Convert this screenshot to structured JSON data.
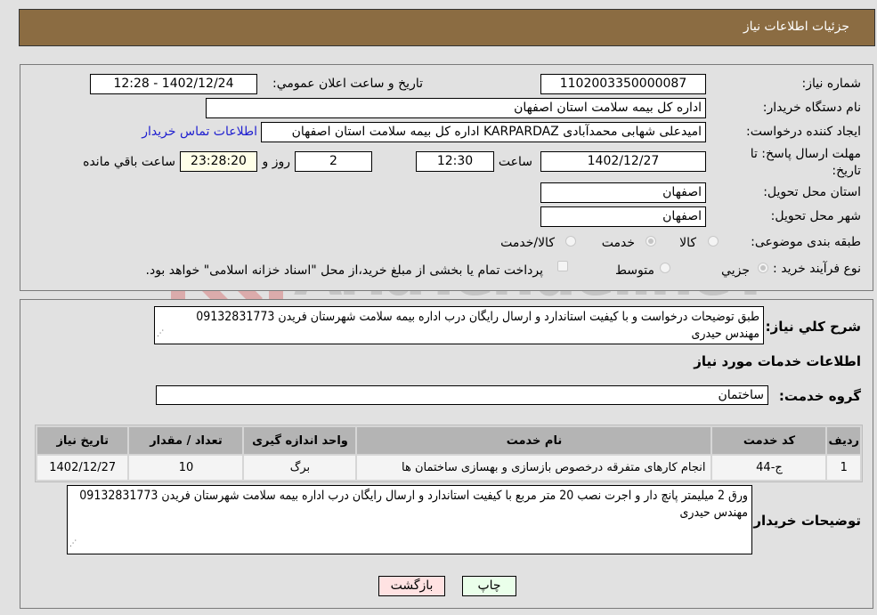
{
  "header": {
    "title": "جزئیات اطلاعات نیاز"
  },
  "watermark": {
    "text": "AriaTender.neT"
  },
  "details": {
    "need_number": {
      "label": "شماره نیاز:",
      "value": "1102003350000087"
    },
    "announce_datetime": {
      "label": "تاریخ و ساعت اعلان عمومي:",
      "value": "1402/12/24 - 12:28"
    },
    "buyer_org": {
      "label": "نام دستگاه خریدار:",
      "value": "اداره کل بیمه سلامت استان اصفهان"
    },
    "requester": {
      "label": "ایجاد کننده درخواست:",
      "value": "امیدعلی شهابی محمدآبادی KARPARDAZ اداره کل بیمه سلامت استان اصفهان",
      "contact_link": "اطلاعات تماس خریدار"
    },
    "deadline": {
      "label": "مهلت ارسال پاسخ: تا تاریخ:",
      "date": "1402/12/27",
      "time_label": "ساعت",
      "time": "12:30",
      "days": "2",
      "days_label": "روز و",
      "remaining": "23:28:20",
      "remaining_label": "ساعت باقي مانده"
    },
    "delivery_province": {
      "label": "استان محل تحویل:",
      "value": "اصفهان"
    },
    "delivery_city": {
      "label": "شهر محل تحویل:",
      "value": "اصفهان"
    },
    "category": {
      "label": "طبقه بندی موضوعی:",
      "options": [
        "کالا",
        "خدمت",
        "کالا/خدمت"
      ],
      "selected": "خدمت"
    },
    "purchase_type": {
      "label": "نوع فرآیند خرید :",
      "options": [
        "جزيي",
        "متوسط"
      ],
      "selected": "جزيي",
      "treasury_note": "پرداخت تمام یا بخشی از مبلغ خرید،از محل \"اسناد خزانه اسلامی\" خواهد بود.",
      "treasury_checked": false
    }
  },
  "need_description": {
    "label": "شرح کلي نیاز:",
    "value": "طبق توضیحات درخواست و با کیفیت استاندارد و ارسال رایگان درب اداره بیمه سلامت شهرستان فریدن 09132831773 مهندس حیدری"
  },
  "services": {
    "section_title": "اطلاعات خدمات مورد نیاز",
    "group_label": "گروه خدمت:",
    "group_value": "ساختمان",
    "columns": [
      "ردیف",
      "کد خدمت",
      "نام خدمت",
      "واحد اندازه گیری",
      "تعداد / مقدار",
      "تاریخ نیاز"
    ],
    "rows": [
      {
        "row": "1",
        "code": "ج-44",
        "name": "انجام کارهای متفرقه درخصوص بازسازی و بهسازی ساختمان ها",
        "unit": "برگ",
        "qty": "10",
        "date": "1402/12/27"
      }
    ]
  },
  "buyer_notes": {
    "label": "توضیحات خریدار:",
    "value": "ورق 2 میلیمتر پانچ دار و اجرت نصب 20 متر مربع با کیفیت استاندارد و ارسال رایگان درب اداره بیمه سلامت شهرستان فریدن 09132831773 مهندس حیدری"
  },
  "buttons": {
    "print": "چاپ",
    "back": "بازگشت"
  }
}
